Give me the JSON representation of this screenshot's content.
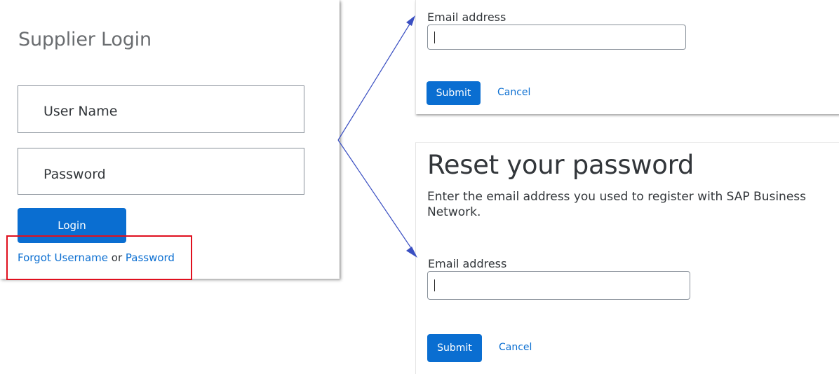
{
  "login_card": {
    "title": "Supplier Login",
    "username_placeholder": "User Name",
    "password_placeholder": "Password",
    "login_label": "Login",
    "forgot_username_link": "Forgot Username",
    "or_text": " or ",
    "forgot_password_link": "Password"
  },
  "forgot_username_panel": {
    "email_label": "Email address",
    "email_value": "",
    "submit_label": "Submit",
    "cancel_label": "Cancel"
  },
  "reset_password_panel": {
    "title": "Reset your password",
    "description": "Enter the email address you used to register with SAP Business Network.",
    "email_label": "Email address",
    "email_value": "",
    "submit_label": "Submit",
    "cancel_label": "Cancel"
  },
  "colors": {
    "accent": "#0a6ed1",
    "highlight": "#e0101e",
    "arrow": "#3a4fc2"
  },
  "icons": [
    "annotation-arrow-up",
    "annotation-arrow-down"
  ]
}
